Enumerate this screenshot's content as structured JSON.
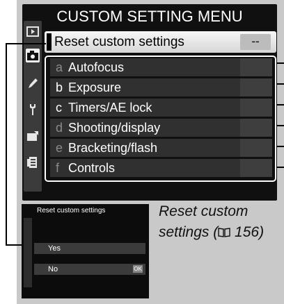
{
  "screen": {
    "title": "CUSTOM SETTING MENU",
    "reset_label": "Reset custom settings",
    "reset_value": "--",
    "banks": [
      {
        "letter": "a",
        "label": "Autofocus"
      },
      {
        "letter": "b",
        "label": "Exposure"
      },
      {
        "letter": "c",
        "label": "Timers/AE lock"
      },
      {
        "letter": "d",
        "label": "Shooting/display"
      },
      {
        "letter": "e",
        "label": "Bracketing/flash"
      },
      {
        "letter": "f",
        "label": "Controls"
      }
    ],
    "tab_icons": [
      "play-icon",
      "camera-icon",
      "pencil-icon",
      "wrench-icon",
      "retouch-icon",
      "my-menu-icon"
    ]
  },
  "thumbnail": {
    "title": "Reset custom settings",
    "yes": "Yes",
    "no": "No",
    "ok": "OK"
  },
  "caption": {
    "text": "Reset custom settings (",
    "icon": "book-icon",
    "page": " 156)"
  }
}
